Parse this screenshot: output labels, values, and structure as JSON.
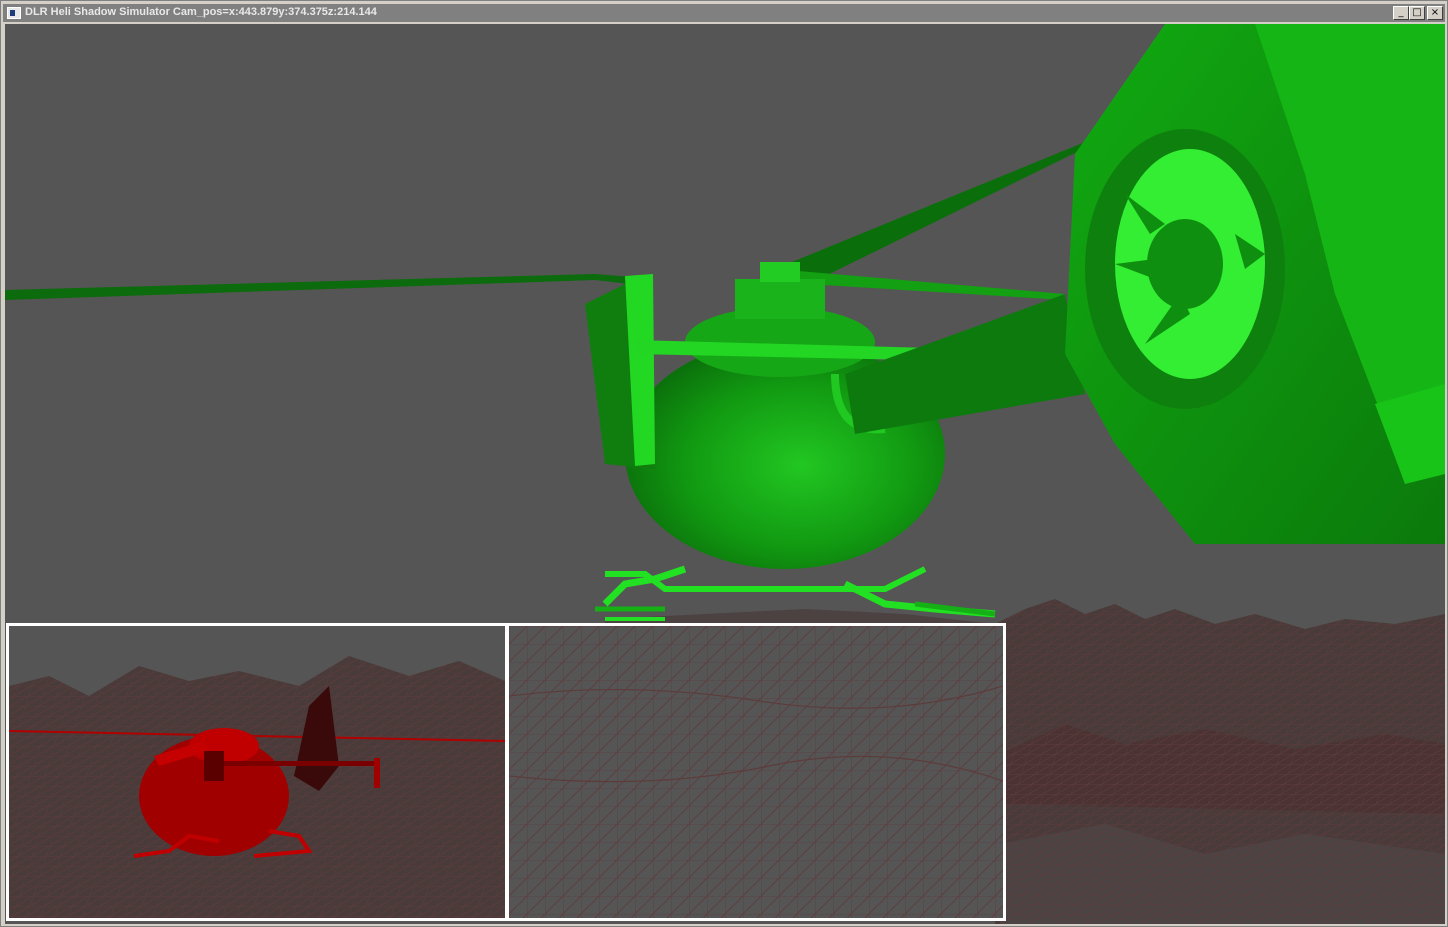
{
  "window": {
    "title": "DLR Heli Shadow Simulator Cam_pos=x:443.879y:374.375z:214.144",
    "icon": "app-window-icon",
    "controls": {
      "minimize": "_",
      "maximize": "□",
      "close": "×"
    }
  },
  "scene": {
    "background_color": "#555555",
    "heli_main_color": "#00cc00",
    "heli_shadow_color": "#b00000",
    "terrain_wire_color": "#5a3a3a",
    "inset_border_color": "#ffffff"
  }
}
